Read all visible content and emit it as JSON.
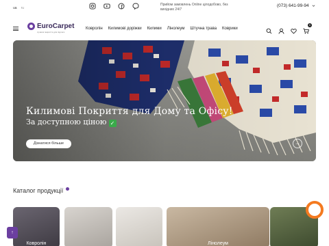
{
  "topbar": {
    "languages": [
      "ua",
      "ru"
    ],
    "socials": [
      "instagram-icon",
      "youtube-icon",
      "facebook-icon",
      "viber-icon"
    ],
    "hours_line1": "Прийом замовлень Online цілодобово, без",
    "hours_line2": "вихідних 24/7",
    "phone": "(073) 641-99-94"
  },
  "header": {
    "logo_text": "EuroCarpet",
    "logo_sub": "сучасні покриття для підлоги",
    "nav": [
      "Ковролін",
      "Килимові доріжки",
      "Килими",
      "Лінолеум",
      "Штучна трава",
      "Коврики"
    ],
    "cart_count": "0"
  },
  "hero": {
    "title": "Килимові Покриття для Дому та Офісу!",
    "subtitle": "За доступною ціною",
    "button": "Дізнатися більше",
    "arrow": "→"
  },
  "catalog": {
    "title": "Каталог продукції",
    "cards": [
      {
        "label": "Ковролін"
      },
      {
        "label": ""
      },
      {
        "label": ""
      },
      {
        "label": "Лінолеум"
      },
      {
        "label": ""
      }
    ]
  },
  "colors": {
    "accent": "#6b3fa0",
    "orange": "#f47a20"
  }
}
